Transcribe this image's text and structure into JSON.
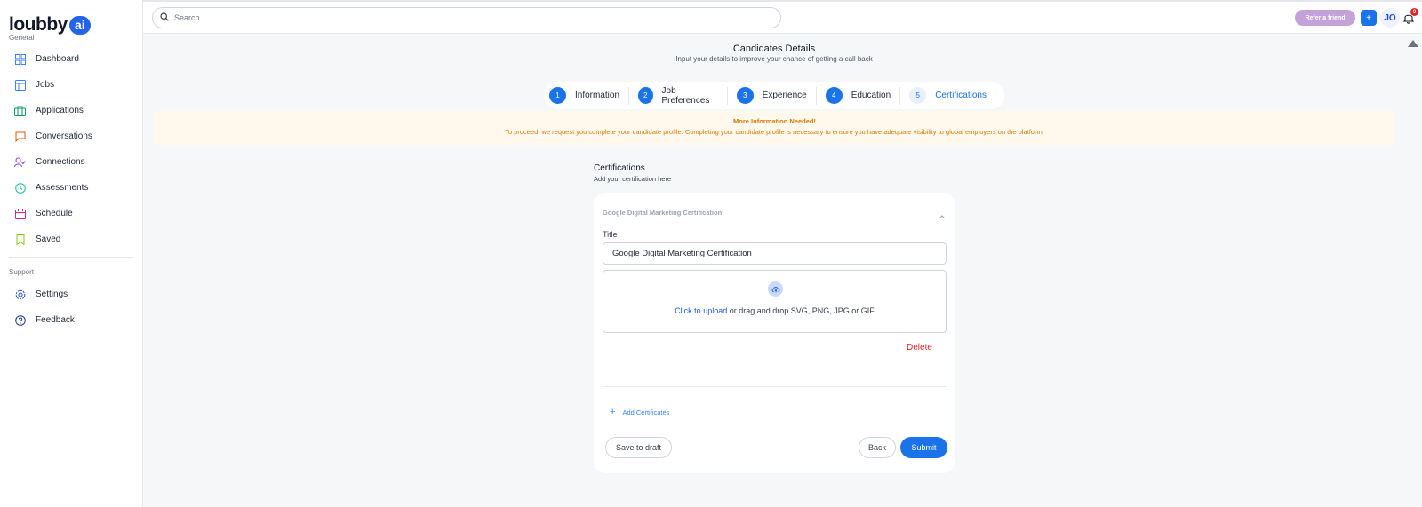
{
  "brand": {
    "name": "loubby",
    "ai": "ai"
  },
  "sidebar": {
    "general_label": "General",
    "support_label": "Support",
    "items": [
      {
        "label": "Dashboard",
        "icon": "dashboard-icon"
      },
      {
        "label": "Jobs",
        "icon": "jobs-icon"
      },
      {
        "label": "Applications",
        "icon": "applications-icon"
      },
      {
        "label": "Conversations",
        "icon": "conversations-icon"
      },
      {
        "label": "Connections",
        "icon": "connections-icon"
      },
      {
        "label": "Assessments",
        "icon": "assessments-icon"
      },
      {
        "label": "Schedule",
        "icon": "schedule-icon"
      },
      {
        "label": "Saved",
        "icon": "saved-icon"
      }
    ],
    "support_items": [
      {
        "label": "Settings",
        "icon": "gear-icon"
      },
      {
        "label": "Feedback",
        "icon": "help-icon"
      }
    ]
  },
  "topbar": {
    "search_placeholder": "Search",
    "refer_label": "Refer a friend",
    "plus_label": "+",
    "avatar_initials": "JO",
    "notification_count": "0"
  },
  "header": {
    "title": "Candidates Details",
    "subtitle": "Input your details to improve your chance of getting a call back"
  },
  "stepper": {
    "steps": [
      {
        "num": "1",
        "label": "Information"
      },
      {
        "num": "2",
        "label": "Job Preferences"
      },
      {
        "num": "3",
        "label": "Experience"
      },
      {
        "num": "4",
        "label": "Education"
      },
      {
        "num": "5",
        "label": "Certifications"
      }
    ],
    "active_index": 4
  },
  "banner": {
    "title": "More Information Needed!",
    "text": "To proceed, we request you complete your candidate profile. Completing your candidate profile is necessary to ensure you have adequate visibility to global employers on the platform."
  },
  "certifications": {
    "title": "Certifications",
    "subtitle": "Add your certification here",
    "item_heading": "Google Digital Marketing Certification",
    "title_label": "Title",
    "title_value": "Google Digital Marketing Certification",
    "upload_link": "Click to upload",
    "upload_text": " or drag and drop SVG, PNG, JPG or GIF",
    "delete_label": "Delete",
    "add_label": "Add Certificates",
    "save_draft_label": "Save to draft",
    "back_label": "Back",
    "submit_label": "Submit"
  },
  "colors": {
    "primary": "#1a73e8",
    "warning": "#d97706",
    "danger": "#dc2626",
    "refer": "#c4a2d9"
  }
}
